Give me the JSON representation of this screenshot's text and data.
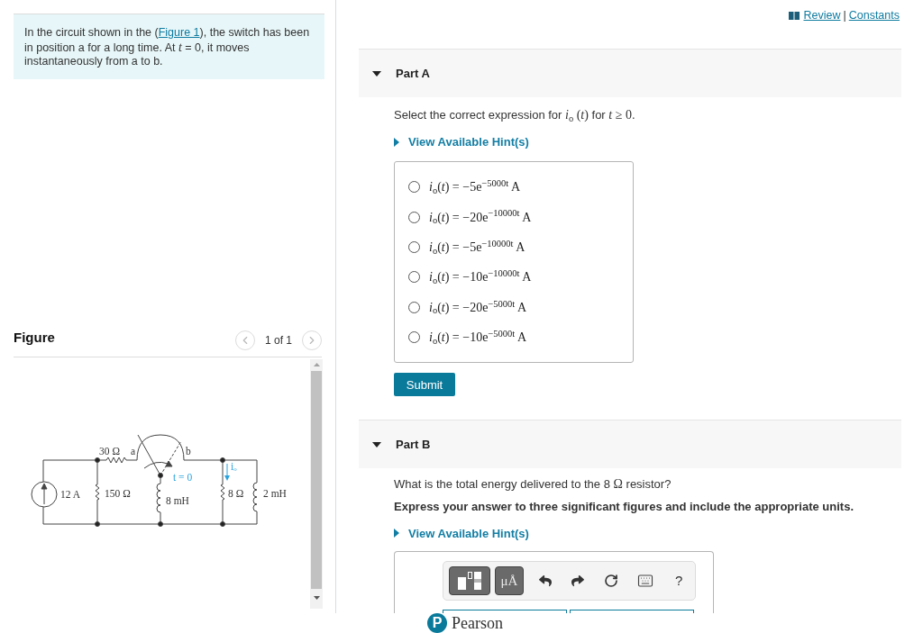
{
  "header_links": {
    "review": "Review",
    "separator": "|",
    "constants": "Constants"
  },
  "problem": {
    "segments": [
      {
        "kind": "text",
        "text": "In the circuit shown in the ("
      },
      {
        "kind": "link",
        "text": "Figure 1"
      },
      {
        "kind": "text",
        "text": "), the switch has been in position a for a long time. At "
      },
      {
        "kind": "math",
        "text": "*t*"
      },
      {
        "kind": "text",
        "text": " = 0, it moves instantaneously from a to b."
      }
    ]
  },
  "figure": {
    "title": "Figure",
    "pager": {
      "text": "1 of 1",
      "prev_disabled": true,
      "next_disabled": true
    },
    "labels": [
      {
        "text": "30 Ω",
        "kind": "component"
      },
      {
        "text": "a",
        "kind": "component"
      },
      {
        "text": "b",
        "kind": "component"
      },
      {
        "text": "t = 0",
        "kind": "annotation"
      },
      {
        "text": "iₒ",
        "kind": "annotation"
      },
      {
        "text": "12 A",
        "kind": "component"
      },
      {
        "text": "150 Ω",
        "kind": "component"
      },
      {
        "text": "8 mH",
        "kind": "component"
      },
      {
        "text": "8 Ω",
        "kind": "component"
      },
      {
        "text": "2 mH",
        "kind": "component"
      }
    ]
  },
  "parts": [
    {
      "kind": "multiple_choice",
      "title": "Part A",
      "expanded": true,
      "question": [
        {
          "kind": "text",
          "text": "Select the correct expression for "
        },
        {
          "kind": "math",
          "text": "*i*$_{o}$ (*t*)"
        },
        {
          "kind": "text",
          "text": " for "
        },
        {
          "kind": "math",
          "text": "*t* ≥ 0"
        },
        {
          "kind": "text",
          "text": "."
        }
      ],
      "hint": {
        "label": "View Available Hint(s)",
        "expanded": false
      },
      "options": [
        {
          "text": "*i*$_{o}$(*t*) = −5e$^{−5000t}$ A",
          "selected": false
        },
        {
          "text": "*i*$_{o}$(*t*) = −20e$^{−10000t}$ A",
          "selected": false
        },
        {
          "text": "*i*$_{o}$(*t*) = −5e$^{−10000t}$ A",
          "selected": false
        },
        {
          "text": "*i*$_{o}$(*t*) = −10e$^{−10000t}$ A",
          "selected": false
        },
        {
          "text": "*i*$_{o}$(*t*) = −20e$^{−5000t}$ A",
          "selected": false
        },
        {
          "text": "*i*$_{o}$(*t*) = −10e$^{−5000t}$ A",
          "selected": false
        }
      ],
      "submit": "Submit"
    },
    {
      "kind": "answer_entry",
      "title": "Part B",
      "expanded": true,
      "question": [
        {
          "kind": "text",
          "text": "What is the total energy delivered to the 8 "
        },
        {
          "kind": "math",
          "text": "Ω"
        },
        {
          "kind": "text",
          "text": " resistor?"
        }
      ],
      "instruction": "Express your answer to three significant figures and include the appropriate units.",
      "hint": {
        "label": "View Available Hint(s)",
        "expanded": false
      },
      "toolbar": {
        "units_button": "μÅ",
        "help_button": "?"
      }
    }
  ],
  "footer": {
    "logo_mark": "P",
    "logo_text": "Pearson"
  }
}
